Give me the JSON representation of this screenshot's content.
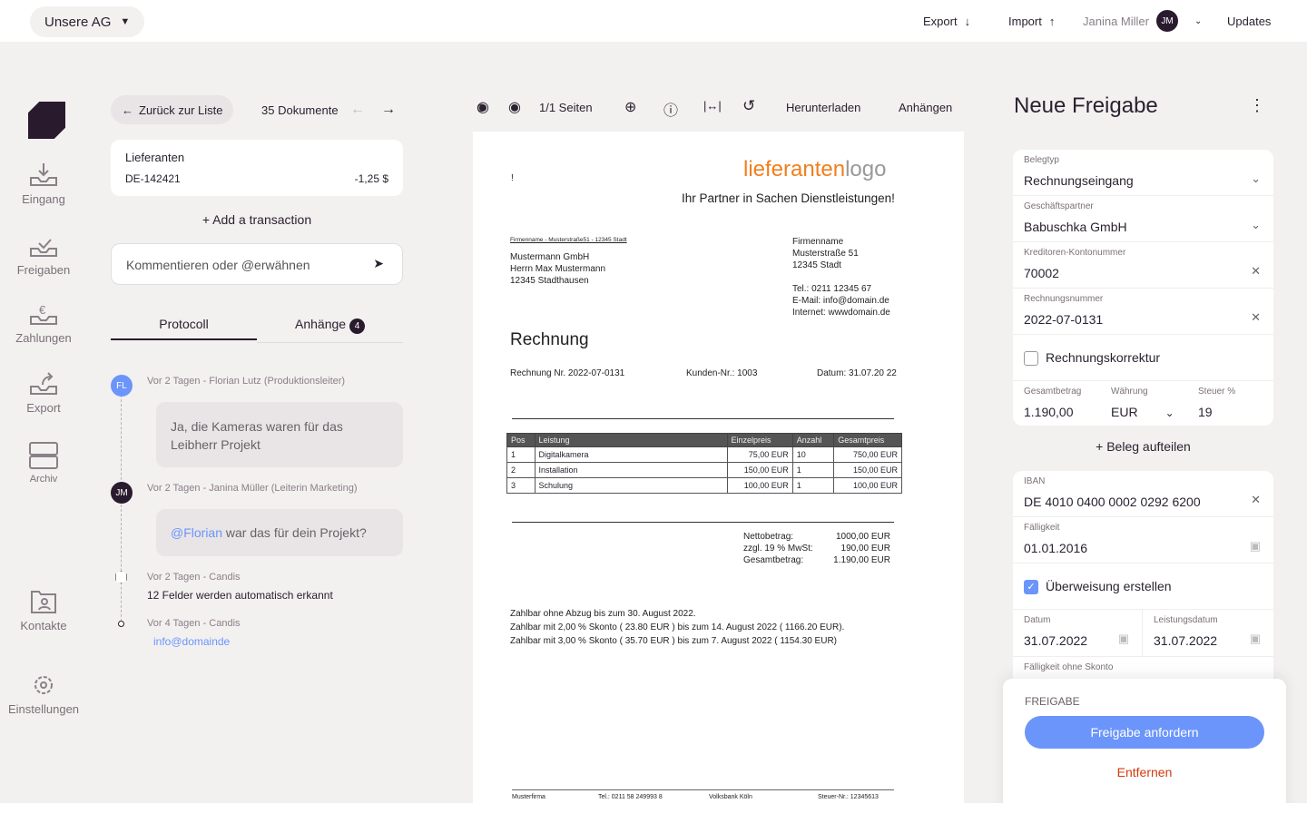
{
  "topbar": {
    "org": "Unsere AG",
    "export": "Export",
    "import": "Import",
    "user": "Janina Miller",
    "user_initials": "JM",
    "updates": "Updates"
  },
  "nav": [
    {
      "label": "Eingang"
    },
    {
      "label": "Freigaben"
    },
    {
      "label": "Zahlungen"
    },
    {
      "label": "Export"
    },
    {
      "label": "Archiv"
    },
    {
      "label": "Kontakte"
    },
    {
      "label": "Einstellungen"
    }
  ],
  "left": {
    "back": "Zurück zur Liste",
    "doc_count": "35 Dokumente",
    "supplier_label": "Lieferanten",
    "supplier_id": "DE-142421",
    "amount": "-1,25 $",
    "add_transaction": "Add a transaction",
    "comment_placeholder": "Kommentieren oder @erwähnen",
    "tabs": [
      {
        "label": "Protocoll"
      },
      {
        "label": "Anhänge",
        "badge": "4"
      }
    ],
    "timeline": [
      {
        "initials": "FL",
        "meta": "Vor 2 Tagen - Florian Lutz (Produktionsleiter)",
        "text": "Ja, die Kameras waren für das Leibherr Projekt"
      },
      {
        "initials": "JM",
        "meta": "Vor 2 Tagen - Janina Müller (Leiterin Marketing)",
        "mention": "@Florian",
        "text": " war das für dein Projekt?"
      },
      {
        "meta": "Vor 2 Tagen - Candis",
        "text": "12 Felder werden automatisch erkannt"
      },
      {
        "meta": "Vor 4 Tagen - Candis",
        "link": "info@domainde"
      }
    ]
  },
  "viewer": {
    "pages": "1/1 Seiten",
    "download": "Herunterladen",
    "attach": "Anhängen"
  },
  "invoice": {
    "logo_a": "lieferanten",
    "logo_b": "logo",
    "tagline": "Ihr Partner in Sachen Dienstleistungen!",
    "mark": "!",
    "sender_line": "Firmenname - Musterstraße51 - 12345 Stadt",
    "recipient": [
      "Mustermann GmbH",
      "Herrn Max Mustermann",
      "12345 Stadthausen"
    ],
    "company": [
      "Firmenname",
      "Musterstraße 51",
      "12345 Stadt"
    ],
    "contact": [
      "Tel.: 0211 12345 67",
      "E-Mail: info@domain.de",
      "Internet: wwwdomain.de"
    ],
    "title": "Rechnung",
    "number": "Rechnung Nr. 2022-07-0131",
    "customer": "Kunden-Nr.: 1003",
    "date": "Datum: 31.07.20 22",
    "headers": [
      "Pos",
      "Leistung",
      "Einzelpreis",
      "Anzahl",
      "Gesamtpreis"
    ],
    "rows": [
      [
        "1",
        "Digitalkamera",
        "75,00 EUR",
        "10",
        "750,00 EUR"
      ],
      [
        "2",
        "Installation",
        "150,00 EUR",
        "1",
        "150,00 EUR"
      ],
      [
        "3",
        "Schulung",
        "100,00 EUR",
        "1",
        "100,00 EUR"
      ]
    ],
    "totals": [
      [
        "Nettobetrag:",
        "1000,00 EUR"
      ],
      [
        "zzgl. 19 % MwSt:",
        "190,00 EUR"
      ],
      [
        "Gesamtbetrag:",
        "1.190,00 EUR"
      ]
    ],
    "terms": [
      "Zahlbar ohne Abzug bis zum 30. August 2022.",
      "Zahlbar mit 2,00 % Skonto ( 23.80 EUR ) bis zum 14. August 2022 ( 1166.20 EUR).",
      "Zahlbar mit 3,00 % Skonto ( 35.70 EUR ) bis zum 7. August 2022 ( 1154.30 EUR)"
    ],
    "footer": [
      "Musterfirma",
      "Tel.: 0211 58 249993 8",
      "Volksbank Köln",
      "Steuer-Nr.: 12345613"
    ]
  },
  "form": {
    "title": "Neue Freigabe",
    "belegtyp_label": "Belegtyp",
    "belegtyp": "Rechnungseingang",
    "partner_label": "Geschäftspartner",
    "partner": "Babuschka GmbH",
    "kreditor_label": "Kreditoren-Kontonummer",
    "kreditor": "70002",
    "rnr_label": "Rechnungsnummer",
    "rnr": "2022-07-0131",
    "korrektur": "Rechnungskorrektur",
    "gesamt_label": "Gesamtbetrag",
    "gesamt": "1.190,00",
    "waehrung_label": "Währung",
    "waehrung": "EUR",
    "steuer_label": "Steuer %",
    "steuer": "19",
    "split": "Beleg aufteilen",
    "iban_label": "IBAN",
    "iban": "DE 4010 0400 0002 0292 6200",
    "faellig_label": "Fälligkeit",
    "faellig": "01.01.2016",
    "ueberweisung": "Überweisung erstellen",
    "datum_label": "Datum",
    "datum": "31.07.2022",
    "leistung_label": "Leistungsdatum",
    "leistung": "31.07.2022",
    "skonto_label": "Fälligkeit ohne Skonto",
    "freigabe_heading": "FREIGABE",
    "request": "Freigabe anfordern",
    "remove": "Entfernen"
  },
  "colors": {
    "accent": "#6b95fb",
    "danger": "#d4380d",
    "dark": "#2a1a2e",
    "logo": "#f07f1c"
  }
}
